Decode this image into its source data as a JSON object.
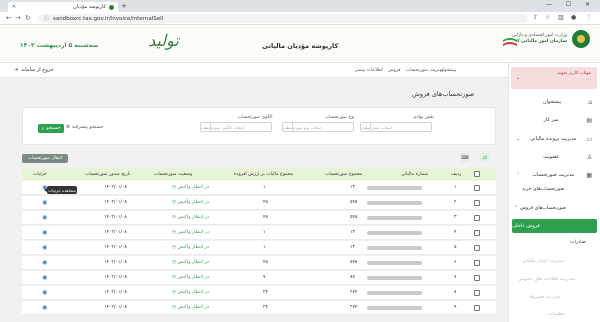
{
  "browser": {
    "tab_title": "کارپوشه مؤدیان",
    "url": "sandboxrc.tax.gov.ir/invoice/internalSell"
  },
  "header": {
    "org_name": "سازمان امور مالیاتی کشور",
    "org_ministry": "وزارت امور اقتصادی و دارایی",
    "portal_title": "کارپوشه مؤدیان مالیاتی",
    "calligraphy": "تولید",
    "date": "سه‌شنبه ۵ اردیبهشت ۱۴۰۲"
  },
  "breadcrumb": [
    "پیشخوان",
    "مدیریت صورتحساب",
    "فروش",
    "اطلاعات بیشتر"
  ],
  "logout_label": "خروج از سامانه",
  "user": {
    "line1": "مهتاب کاربر نمونه",
    "line2": "..."
  },
  "sidebar": {
    "items": [
      {
        "label": "پیشخوان",
        "icon": "home-icon"
      },
      {
        "label": "میز کار",
        "icon": "desk-icon"
      },
      {
        "label": "مدیریت پرونده مالیاتی",
        "icon": "folder-icon"
      },
      {
        "label": "عضویت",
        "icon": "user-icon"
      },
      {
        "label": "مدیریت صورتحساب",
        "icon": "invoice-icon"
      }
    ],
    "sub_buy": "صورتحساب‌های خرید",
    "sub_sell": "صورتحساب‌های فروش",
    "active": "فروش داخلی",
    "export": "صادرات",
    "dim_items": [
      "مدیریت اعتبار مالیاتی",
      "مدیریت اطلاعیه های عمومی",
      "مدیریت تعیین‌ها",
      "تنظیمات"
    ]
  },
  "page_title": "صورتحساب‌های فروش",
  "filters": {
    "role_label": "نقش نهادی",
    "role_placeholder": "انتخاب نقش نهادی",
    "type_label": "نوع صورتحساب",
    "type_placeholder": "انتخاب نوع صورتحساب",
    "pattern_label": "الگوی صورتحساب",
    "pattern_placeholder": "انتخاب الگوی صورتحساب",
    "search_label": "جستجو",
    "advanced_label": "جستجو پیشرفته"
  },
  "excel_label": "انتقال صورتحساب",
  "tooltip": "مشاهده جزئیات",
  "table": {
    "headers": [
      "ردیف",
      "شماره مالیاتی",
      "مجموع صورتحساب",
      "مجموع مالیات بر ارزش افزوده",
      "وضعیت صورتحساب",
      "تاریخ صدور صورتحساب",
      "جزئیات"
    ],
    "rows": [
      {
        "idx": "۱",
        "total": "۱۳",
        "vat": "۱",
        "status": "در انتظار واکنش",
        "date": "۱۴۰۲/۰۱/۰۸"
      },
      {
        "idx": "۲",
        "total": "۵۴۵",
        "vat": "۴۵",
        "status": "در انتظار واکنش",
        "date": "۱۴۰۲/۰۱/۰۸"
      },
      {
        "idx": "۳",
        "total": "۵۴۵",
        "vat": "۴۵",
        "status": "در انتظار واکنش",
        "date": "۱۴۰۲/۰۱/۰۸"
      },
      {
        "idx": "۴",
        "total": "۱۳",
        "vat": "۱",
        "status": "در انتظار واکنش",
        "date": "۱۴۰۲/۰۱/۰۸"
      },
      {
        "idx": "۵",
        "total": "۱۳",
        "vat": "۱",
        "status": "در انتظار واکنش",
        "date": "۱۴۰۲/۰۱/۰۸"
      },
      {
        "idx": "۶",
        "total": "۵۴۵",
        "vat": "۴۵",
        "status": "در انتظار واکنش",
        "date": "۱۴۰۲/۰۱/۰۸"
      },
      {
        "idx": "۷",
        "total": "۸۷",
        "vat": "۷",
        "status": "در انتظار واکنش",
        "date": "۱۴۰۲/۰۱/۰۸"
      },
      {
        "idx": "۸",
        "total": "۲۷۴",
        "vat": "۲۴",
        "status": "در انتظار واکنش",
        "date": "۱۴۰۲/۰۱/۰۸"
      },
      {
        "idx": "۹",
        "total": "۲۷۴",
        "vat": "۲۴",
        "status": "در انتظار واکنش",
        "date": "۱۴۰۲/۰۱/۰۸"
      }
    ]
  },
  "colors": {
    "accent": "#2e9e4f",
    "header_row": "#e8f4d7",
    "status": "#3a9a55"
  }
}
